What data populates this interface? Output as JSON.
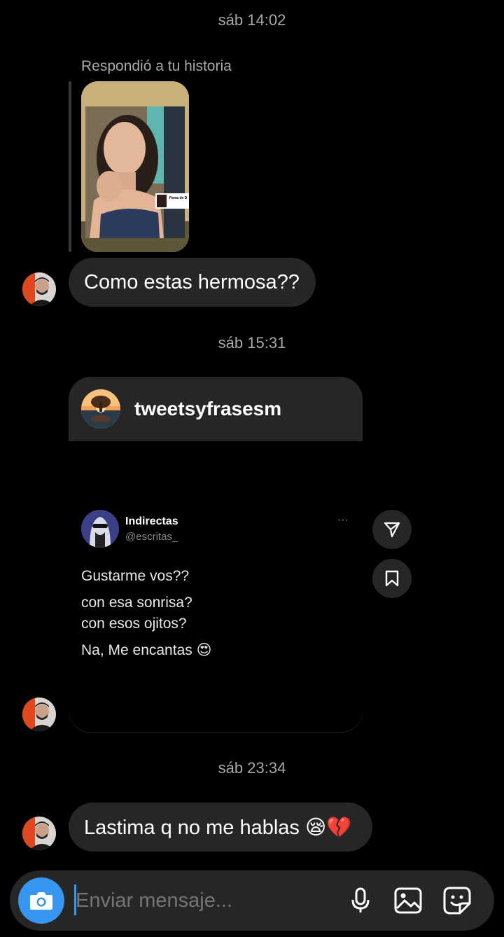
{
  "thread": {
    "timestamps": [
      "sáb 14:02",
      "sáb 15:31",
      "sáb 23:34"
    ],
    "story_reply": {
      "label": "Respondió a tu historia",
      "thumb_caption": "Fama de D"
    },
    "messages": [
      {
        "text": "Como estas hermosa??"
      },
      {
        "text": "Lastima q no me hablas 😪💔"
      }
    ],
    "shared_post": {
      "account": "tweetsyfrasesm",
      "tweet": {
        "name": "Indirectas",
        "handle": "@escritas_",
        "more": "···",
        "line1": "Gustarme vos??",
        "line2": "con esa sonrisa?",
        "line3": "con esos ojitos?",
        "line4": "Na, Me encantas 😍"
      }
    }
  },
  "composer": {
    "placeholder": "Enviar mensaje...",
    "icons": [
      "camera-icon",
      "microphone-icon",
      "gallery-icon",
      "sticker-icon"
    ],
    "camera_color": "#3797f0"
  },
  "actions": [
    "share-icon",
    "save-icon"
  ]
}
